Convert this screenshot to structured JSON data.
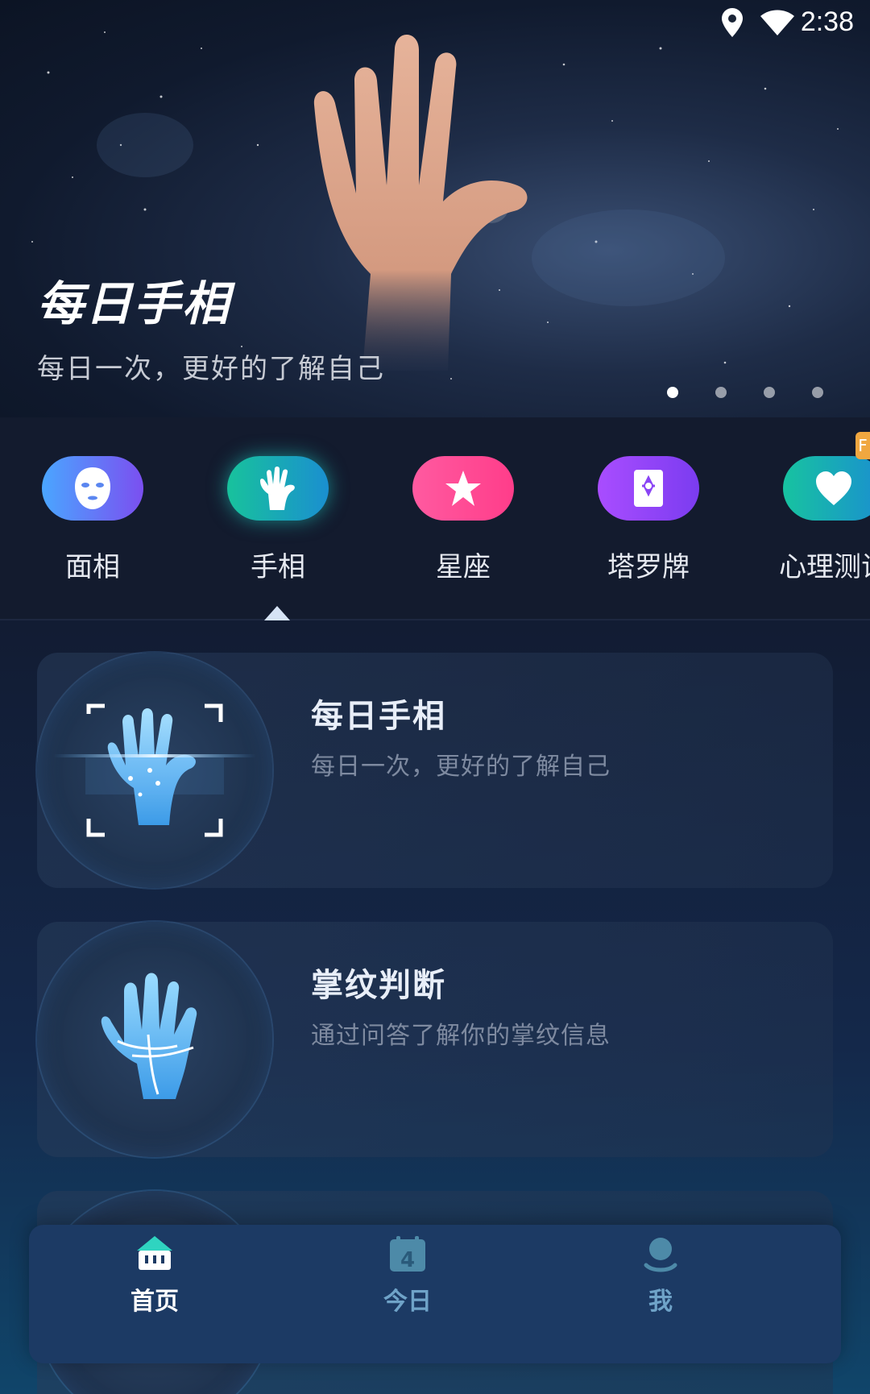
{
  "status_bar": {
    "time": "2:38",
    "icons": [
      "location-icon",
      "wifi-icon"
    ]
  },
  "banner": {
    "title": "每日手相",
    "subtitle": "每日一次，更好的了解自己",
    "page_count": 4,
    "active_page": 1
  },
  "categories": {
    "items": [
      {
        "label": "面相",
        "icon": "face-mask-icon",
        "color_from": "#4aa6ff",
        "color_to": "#7b4ff0"
      },
      {
        "label": "手相",
        "icon": "hand-icon",
        "color_from": "#18c29c",
        "color_to": "#1a8fd0",
        "selected": true
      },
      {
        "label": "星座",
        "icon": "star-icon",
        "color_from": "#ff5aa0",
        "color_to": "#ff3d8a"
      },
      {
        "label": "塔罗牌",
        "icon": "tarot-card-icon",
        "color_from": "#a94dff",
        "color_to": "#7b3cf0"
      },
      {
        "label": "心理测试",
        "icon": "heart-icon",
        "color_from": "#17c3a0",
        "color_to": "#1a8fd0"
      }
    ],
    "badge_text": "F"
  },
  "cards": [
    {
      "title": "每日手相",
      "description": "每日一次，更好的了解自己",
      "icon": "palm-scan-icon"
    },
    {
      "title": "掌纹判断",
      "description": "通过问答了解你的掌纹信息",
      "icon": "palm-lines-icon"
    }
  ],
  "bottom_nav": {
    "items": [
      {
        "label": "首页",
        "icon": "home-icon",
        "active": true
      },
      {
        "label": "今日",
        "icon": "calendar-icon",
        "badge": "4"
      },
      {
        "label": "我",
        "icon": "profile-icon"
      }
    ],
    "active_color": "#ffffff",
    "inactive_color": "#6fa3c8"
  }
}
